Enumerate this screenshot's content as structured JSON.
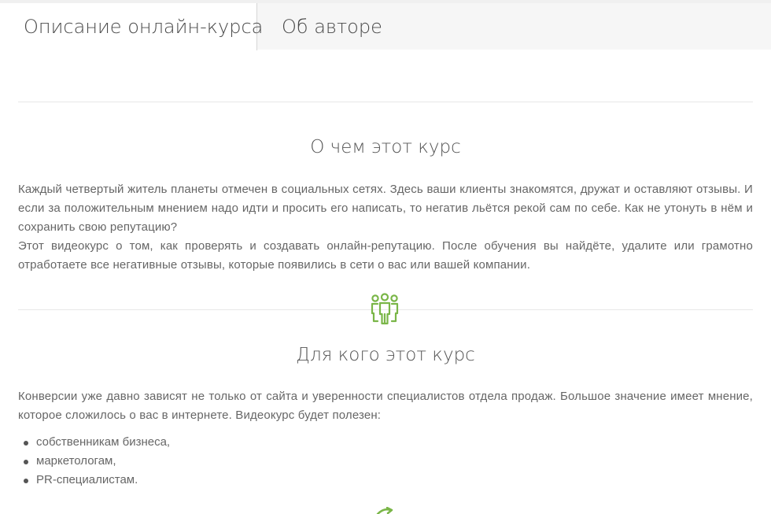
{
  "tabs": [
    {
      "label": "Описание онлайн-курса",
      "active": true
    },
    {
      "label": "Об авторе",
      "active": false
    }
  ],
  "sections": [
    {
      "title": "О чем этот курс",
      "paragraphs": [
        "Каждый четвертый житель планеты отмечен в социальных сетях. Здесь ваши клиенты знакомятся, дружат и оставляют отзывы. И если за положительным мнением надо идти и просить  его написать, то негатив льётся рекой сам по себе. Как не утонуть в нём и сохранить свою репутацию?",
        "Этот видеокурс о том, как проверять и создавать онлайн-репутацию. После обучения вы найдёте, удалите или грамотно отработаете все негативные отзывы, которые появились в сети о вас или вашей компании."
      ]
    },
    {
      "icon": "people-group-icon",
      "title": "Для кого этот курс",
      "paragraphs": [
        "Конверсии уже давно зависят не только от сайта и уверенности специалистов отдела продаж. Большое значение имеет мнение, которое сложилось о вас в интернете. Видеокурс будет полезен:"
      ],
      "bullets": [
        "собственникам бизнеса,",
        "маркетологам,",
        "PR-специалистам."
      ]
    }
  ],
  "next_icon": "arrows-icon",
  "colors": {
    "accent": "#7ab648",
    "tabs_bg": "#f6f6f6",
    "text": "#555555"
  }
}
